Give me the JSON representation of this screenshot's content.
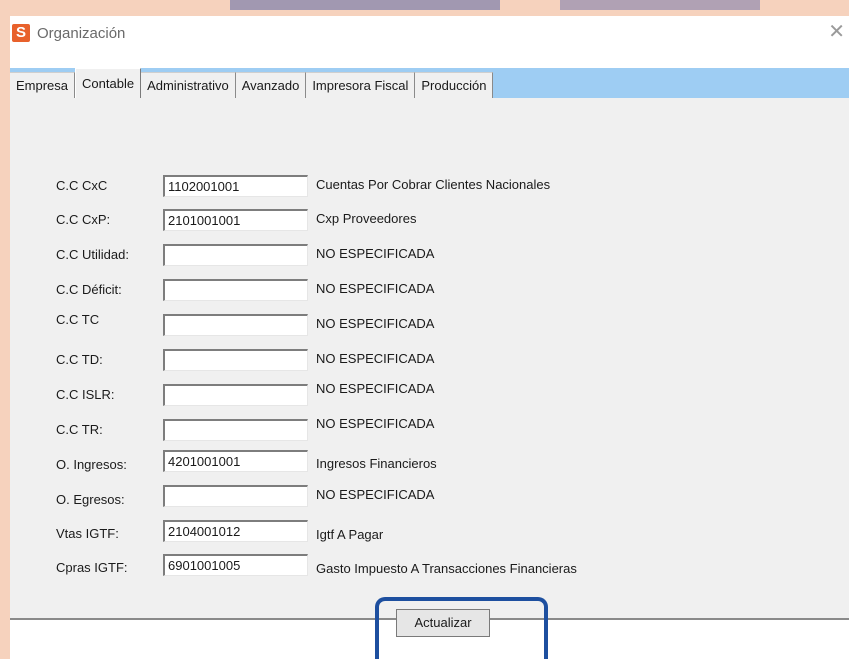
{
  "window": {
    "title": "Organización",
    "app_icon": "S"
  },
  "tabs": [
    {
      "label": "Empresa",
      "active": false
    },
    {
      "label": "Contable",
      "active": true
    },
    {
      "label": "Administrativo",
      "active": false
    },
    {
      "label": "Avanzado",
      "active": false
    },
    {
      "label": "Impresora Fiscal",
      "active": false
    },
    {
      "label": "Producción",
      "active": false
    }
  ],
  "fields": [
    {
      "label": "C.C CxC",
      "value": "1102001001",
      "description": "Cuentas Por Cobrar Clientes Nacionales"
    },
    {
      "label": "C.C CxP:",
      "value": "2101001001",
      "description": "Cxp Proveedores"
    },
    {
      "label": "C.C Utilidad:",
      "value": "",
      "description": "NO ESPECIFICADA"
    },
    {
      "label": "C.C Déficit:",
      "value": "",
      "description": "NO ESPECIFICADA"
    },
    {
      "label": "C.C TC",
      "value": "",
      "description": "NO ESPECIFICADA"
    },
    {
      "label": "C.C TD:",
      "value": "",
      "description": "NO ESPECIFICADA"
    },
    {
      "label": "C.C ISLR:",
      "value": "",
      "description": "NO ESPECIFICADA"
    },
    {
      "label": "C.C TR:",
      "value": "",
      "description": "NO ESPECIFICADA"
    },
    {
      "label": "O. Ingresos:",
      "value": "4201001001",
      "description": "Ingresos Financieros"
    },
    {
      "label": "O. Egresos:",
      "value": "",
      "description": "NO ESPECIFICADA"
    },
    {
      "label": "Vtas IGTF:",
      "value": "2104001012",
      "description": "Igtf A Pagar"
    },
    {
      "label": "Cpras IGTF:",
      "value": "6901001005",
      "description": "Gasto Impuesto A Transacciones Financieras"
    }
  ],
  "footer": {
    "update_label": "Actualizar"
  },
  "colors": {
    "tab_strip": "#9ecdf3",
    "highlight": "#1d4f9f",
    "app_icon": "#e8612c",
    "background": "#f6d2bd"
  }
}
